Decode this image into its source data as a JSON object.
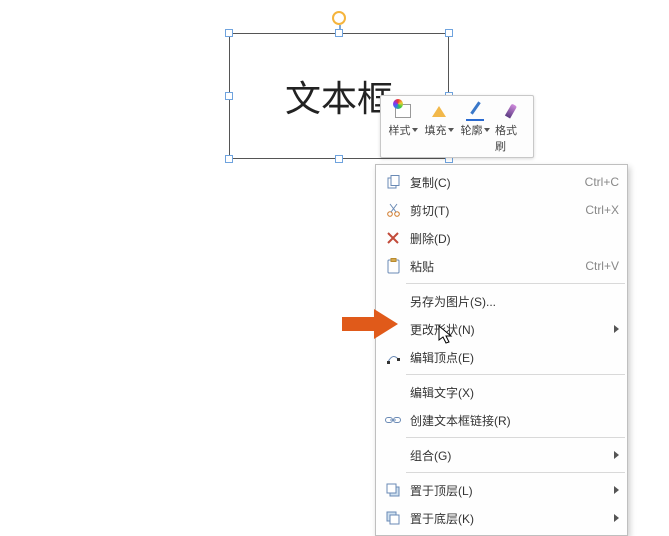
{
  "textbox": {
    "content": "文本框"
  },
  "toolbar": {
    "style": "样式",
    "fill": "填充",
    "outline": "轮廓",
    "format_painter": "格式刷"
  },
  "menu": {
    "copy": {
      "label": "复制(C)",
      "shortcut": "Ctrl+C"
    },
    "cut": {
      "label": "剪切(T)",
      "shortcut": "Ctrl+X"
    },
    "delete": {
      "label": "删除(D)",
      "shortcut": ""
    },
    "paste": {
      "label": "粘贴",
      "shortcut": "Ctrl+V"
    },
    "save_as_pic": {
      "label": "另存为图片(S)..."
    },
    "change_shape": {
      "label": "更改形状(N)"
    },
    "edit_points": {
      "label": "编辑顶点(E)"
    },
    "edit_text": {
      "label": "编辑文字(X)"
    },
    "create_link": {
      "label": "创建文本框链接(R)"
    },
    "group": {
      "label": "组合(G)"
    },
    "bring_front": {
      "label": "置于顶层(L)"
    },
    "send_back": {
      "label": "置于底层(K)"
    }
  }
}
